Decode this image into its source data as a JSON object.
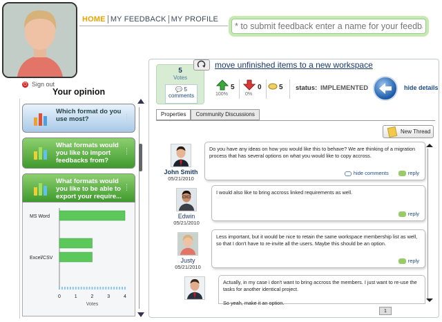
{
  "nav": {
    "home": "HOME",
    "feedback": "MY FEEDBACK",
    "profile": "MY PROFILE"
  },
  "search": {
    "placeholder": "* to submit feedback enter a name for your feedback"
  },
  "user": {
    "signout": "Sign out"
  },
  "opinion": {
    "title": "Your opinion",
    "questions": [
      {
        "text": "Which format do you use most?"
      },
      {
        "text": "What formats would you like to import feedbacks from?"
      },
      {
        "text": "What formats would you like to be able to export your require..."
      }
    ]
  },
  "chart_data": {
    "type": "bar",
    "orientation": "horizontal",
    "categories": [
      "MS Word",
      "",
      "",
      "Excel/CSV",
      ""
    ],
    "values": [
      4,
      0,
      2,
      2,
      0
    ],
    "xlabel": "Votes",
    "xticks": [
      "0",
      "1",
      "2",
      "3",
      "4"
    ],
    "xlim": [
      0,
      4
    ],
    "color": "#5cc85c"
  },
  "item": {
    "votes": "5",
    "votes_label": "Votes",
    "comments": "5",
    "comments_label": "comments",
    "move_link": "move unfinished items to a new workspace",
    "up_count": "5",
    "up_pct": "100%",
    "down_count": "0",
    "down_pct": "0%",
    "comment_count": "5",
    "status_label": "status:",
    "status_value": "IMPLEMENTED",
    "hide_details": "hide details"
  },
  "tabs": [
    "Properties",
    "Community Discussions"
  ],
  "new_thread": "New Thread",
  "discussion": [
    {
      "name": "John Smith",
      "date": "05/21/2010",
      "text": "Do you have any ideas on how you would like this to behave? We are thinking of a migration process that has several options on what you would like to copy accross.",
      "hide": "hide comments",
      "reply": "reply"
    },
    {
      "name": "Edwin",
      "date": "05/21/2010",
      "text": "I would also like to bring accross linked requirements as well.",
      "reply": "reply"
    },
    {
      "name": "Justy",
      "date": "05/21/2010",
      "text": "Less important, but it would be nice to retain the same workspace membership list as well, so that I don't have to re-invite all the users. Maybe this should be an option.",
      "reply": "reply"
    },
    {
      "name": "",
      "date": "",
      "text": "Actually, in my case i don't want to bring accross the members. I just want to re-use the tasks for another identical project.",
      "text2": "So yeah, make it an option."
    }
  ],
  "pager": "1",
  "colors": {
    "accent": "#e8a300",
    "green": "#3f9a2d",
    "link": "#1a3a6a"
  }
}
